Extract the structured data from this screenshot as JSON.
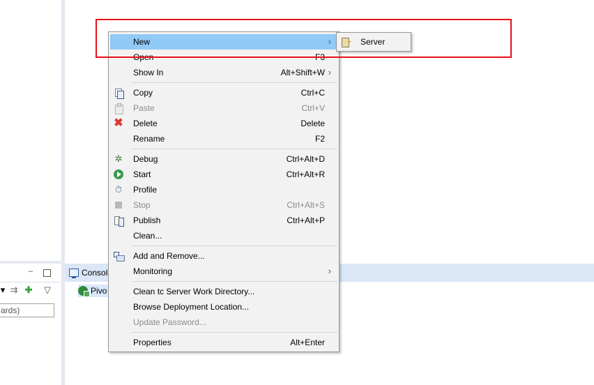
{
  "left_panel": {
    "minimize_glyph": "▭",
    "filter_placeholder": "ards)"
  },
  "console": {
    "tab_label": "Console",
    "server_row_label": "Pivo"
  },
  "context_menu": {
    "items": [
      {
        "label": "New",
        "shortcut": "",
        "submenu": true,
        "highlighted": true,
        "icon": "none"
      },
      {
        "label": "Open",
        "shortcut": "F3",
        "icon": "none"
      },
      {
        "label": "Show In",
        "shortcut": "Alt+Shift+W",
        "submenu": true,
        "icon": "none"
      },
      {
        "label": "Copy",
        "shortcut": "Ctrl+C",
        "icon": "copy-icon"
      },
      {
        "label": "Paste",
        "shortcut": "Ctrl+V",
        "disabled": true,
        "icon": "paste-icon"
      },
      {
        "label": "Delete",
        "shortcut": "Delete",
        "icon": "delete-icon"
      },
      {
        "label": "Rename",
        "shortcut": "F2",
        "icon": "none"
      },
      {
        "label": "Debug",
        "shortcut": "Ctrl+Alt+D",
        "icon": "debug-icon"
      },
      {
        "label": "Start",
        "shortcut": "Ctrl+Alt+R",
        "icon": "start-icon"
      },
      {
        "label": "Profile",
        "shortcut": "",
        "icon": "profile-icon"
      },
      {
        "label": "Stop",
        "shortcut": "Ctrl+Alt+S",
        "disabled": true,
        "icon": "stop-icon"
      },
      {
        "label": "Publish",
        "shortcut": "Ctrl+Alt+P",
        "icon": "publish-icon"
      },
      {
        "label": "Clean...",
        "shortcut": "",
        "icon": "none"
      },
      {
        "label": "Add and Remove...",
        "shortcut": "",
        "icon": "add-remove-icon"
      },
      {
        "label": "Monitoring",
        "shortcut": "",
        "submenu": true,
        "icon": "none"
      },
      {
        "label": "Clean tc Server Work Directory...",
        "shortcut": "",
        "icon": "none"
      },
      {
        "label": "Browse Deployment Location...",
        "shortcut": "",
        "icon": "none"
      },
      {
        "label": "Update Password...",
        "shortcut": "",
        "disabled": true,
        "icon": "none"
      },
      {
        "label": "Properties",
        "shortcut": "Alt+Enter",
        "icon": "none"
      }
    ]
  },
  "submenu_new": {
    "items": [
      {
        "label": "Server",
        "icon": "server-icon"
      }
    ]
  },
  "colors": {
    "menu_highlight": "#91c9f7",
    "annotation_box": "#e8101a",
    "console_tabbar": "#dbe6f7"
  }
}
